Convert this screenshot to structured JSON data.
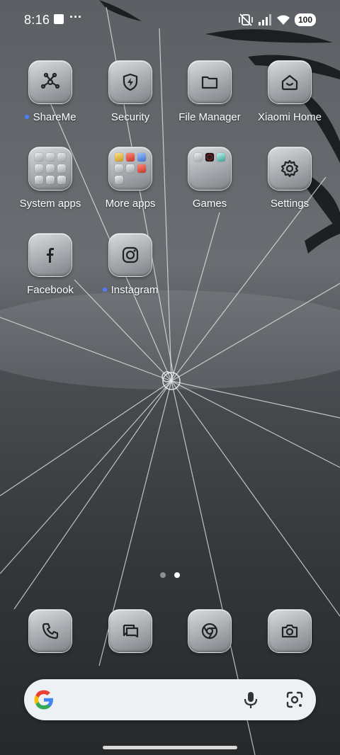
{
  "status_bar": {
    "time": "8:16",
    "overflow": "···",
    "battery": "100",
    "icons": [
      "notification-square-icon",
      "vibrate-mute-icon",
      "signal-icon",
      "wifi-icon",
      "battery-icon"
    ]
  },
  "home": {
    "apps": [
      {
        "label": "ShareMe",
        "icon": "share-nodes-icon",
        "new": true
      },
      {
        "label": "Security",
        "icon": "shield-bolt-icon",
        "new": false
      },
      {
        "label": "File Manager",
        "icon": "folder-icon",
        "new": false
      },
      {
        "label": "Xiaomi Home",
        "icon": "house-icon",
        "new": false
      },
      {
        "label": "System apps",
        "icon": "folder-group-icon",
        "new": false
      },
      {
        "label": "More apps",
        "icon": "folder-group-icon",
        "new": false
      },
      {
        "label": "Games",
        "icon": "folder-group-icon",
        "new": false
      },
      {
        "label": "Settings",
        "icon": "gear-icon",
        "new": false
      },
      {
        "label": "Facebook",
        "icon": "facebook-icon",
        "new": false
      },
      {
        "label": "Instagram",
        "icon": "instagram-icon",
        "new": true
      }
    ]
  },
  "pager": {
    "pages": 2,
    "current": 2
  },
  "dock": {
    "items": [
      {
        "name": "phone",
        "icon": "phone-icon"
      },
      {
        "name": "messages",
        "icon": "messages-icon"
      },
      {
        "name": "chrome",
        "icon": "chrome-icon"
      },
      {
        "name": "camera",
        "icon": "camera-icon"
      }
    ]
  },
  "search": {
    "logo": "google-g-icon",
    "mic": "microphone-icon",
    "lens": "google-lens-icon"
  },
  "colors": {
    "new_dot": "#4c7dff",
    "icon_gradient_top": "#d9dcdf",
    "icon_gradient_bottom": "#7f8387"
  }
}
